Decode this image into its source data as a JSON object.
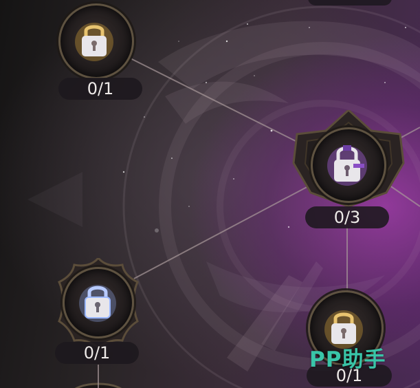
{
  "nodes": {
    "top_left": {
      "count": "0/1",
      "glow": "#d9a53a"
    },
    "center": {
      "count": "0/3",
      "glow": "#9b5bd0"
    },
    "mid_left": {
      "count": "0/1",
      "glow": "#9ab7ff"
    },
    "bottom_right": {
      "count": "0/1",
      "glow": "#d9a53a"
    }
  },
  "watermark": "PP助手",
  "colors": {
    "link_line": "#a8989a",
    "lock_body": "#e8e6ea",
    "purple_glow": "#a23caf"
  }
}
